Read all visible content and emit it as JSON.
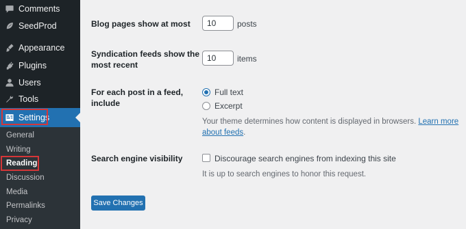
{
  "sidebar": {
    "items": [
      {
        "label": "Comments",
        "icon": "comment-icon"
      },
      {
        "label": "SeedProd",
        "icon": "seedprod-leaf-icon"
      },
      {
        "label": "Appearance",
        "icon": "paintbrush-icon"
      },
      {
        "label": "Plugins",
        "icon": "plugin-icon"
      },
      {
        "label": "Users",
        "icon": "user-icon"
      },
      {
        "label": "Tools",
        "icon": "wrench-icon"
      },
      {
        "label": "Settings",
        "icon": "settings-icon"
      }
    ],
    "submenu": [
      "General",
      "Writing",
      "Reading",
      "Discussion",
      "Media",
      "Permalinks",
      "Privacy"
    ],
    "current_submenu": "Reading"
  },
  "form": {
    "blog_pages": {
      "label": "Blog pages show at most",
      "value": "10",
      "suffix": "posts"
    },
    "syndication": {
      "label_line1": "Syndication feeds show the",
      "label_line2": "most recent",
      "value": "10",
      "suffix": "items"
    },
    "feed_include": {
      "label_line1": "For each post in a feed,",
      "label_line2": "include",
      "options": [
        "Full text",
        "Excerpt"
      ],
      "selected": "Full text",
      "desc_text": "Your theme determines how content is displayed in browsers.",
      "desc_link_part1": "Learn more about",
      "desc_link_part2": "feeds",
      "desc_end": "."
    },
    "search_visibility": {
      "label": "Search engine visibility",
      "checkbox_label": "Discourage search engines from indexing this site",
      "checked": false,
      "desc": "It is up to search engines to honor this request."
    },
    "submit_label": "Save Changes"
  },
  "colors": {
    "accent": "#2271b1",
    "highlight": "#d63638",
    "sidebar_bg": "#1d2327"
  }
}
